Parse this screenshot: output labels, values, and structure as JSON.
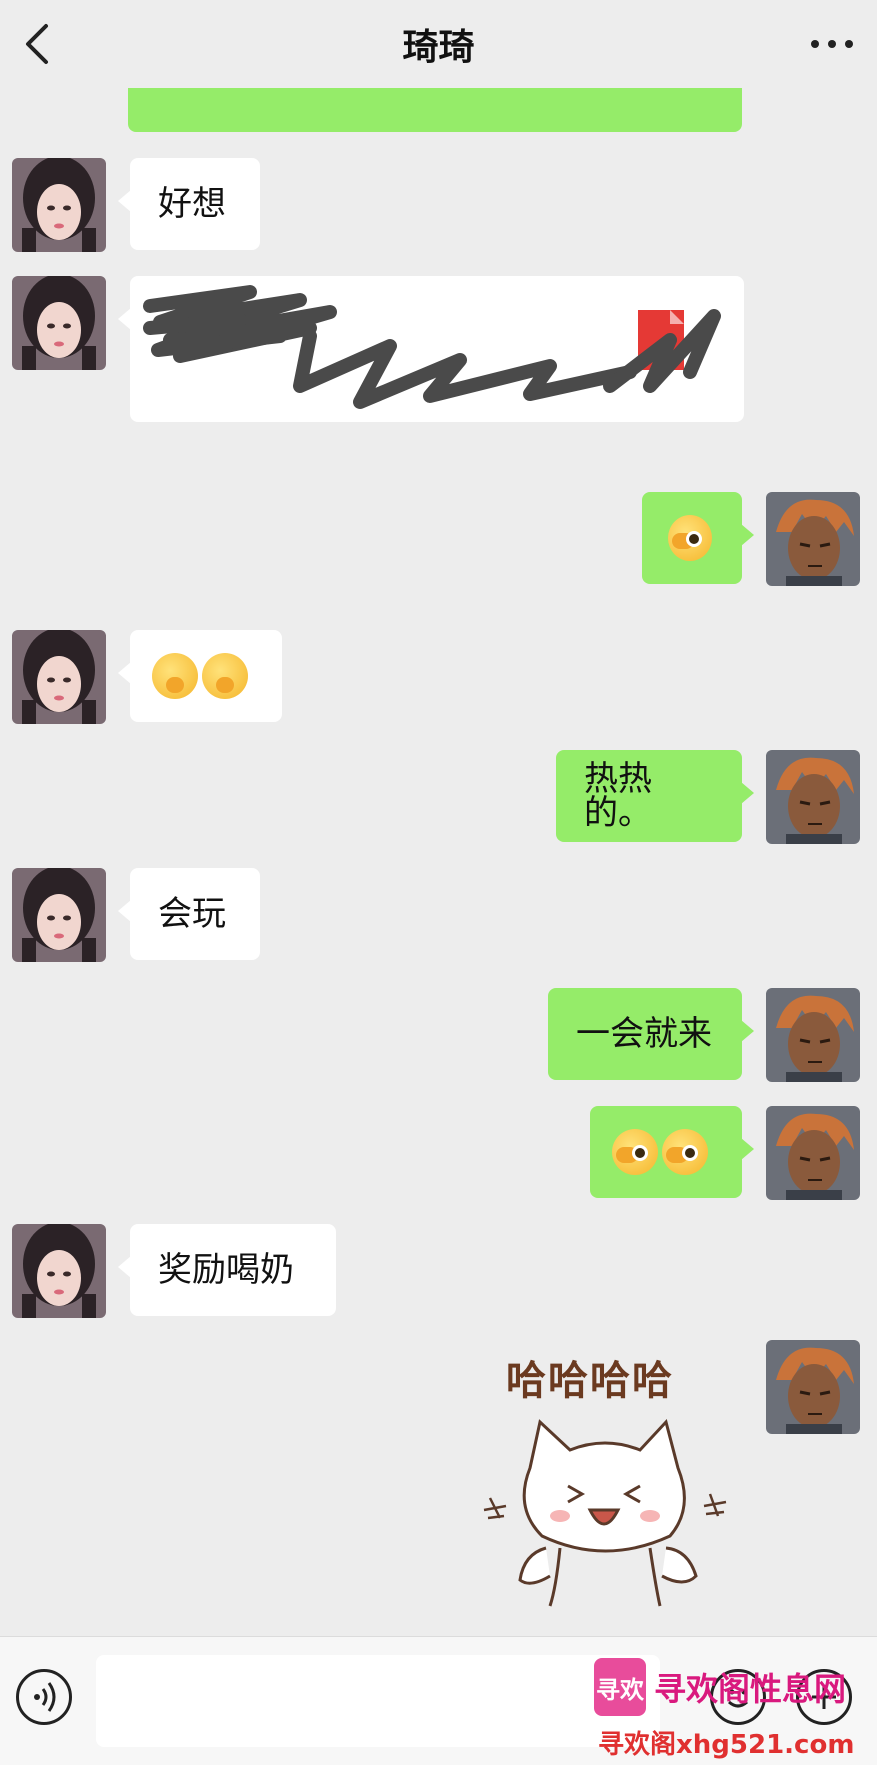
{
  "header": {
    "title": "琦琦",
    "back_icon": "chevron-left-icon",
    "more_icon": "more-dots-icon"
  },
  "messages": [
    {
      "side": "in",
      "text": "好想"
    },
    {
      "side": "in",
      "text": "",
      "content": "scribbled-out-file-card"
    },
    {
      "side": "out",
      "text": "",
      "content": "emoji-facepalm"
    },
    {
      "side": "in",
      "text": "",
      "content": "emoji-giggle-x2"
    },
    {
      "side": "out",
      "text": "热热的。"
    },
    {
      "side": "in",
      "text": "会玩"
    },
    {
      "side": "out",
      "text": "一会就来"
    },
    {
      "side": "out",
      "text": "",
      "content": "emoji-facepalm-x2"
    },
    {
      "side": "in",
      "text": "奖励喝奶"
    },
    {
      "side": "out",
      "text": "哈哈哈哈",
      "content": "cat-sticker"
    }
  ],
  "sticker": {
    "caption": "哈哈哈哈"
  },
  "input_bar": {
    "voice_icon": "voice-icon",
    "emoji_icon": "emoji-icon",
    "plus_icon": "plus-icon",
    "placeholder": ""
  },
  "watermark": {
    "logo_text": "寻欢",
    "line1": "寻欢阁性息网",
    "line2": "寻欢阁xhg521.com"
  },
  "colors": {
    "background": "#ededed",
    "outgoing_bubble": "#95ec69",
    "incoming_bubble": "#ffffff"
  }
}
